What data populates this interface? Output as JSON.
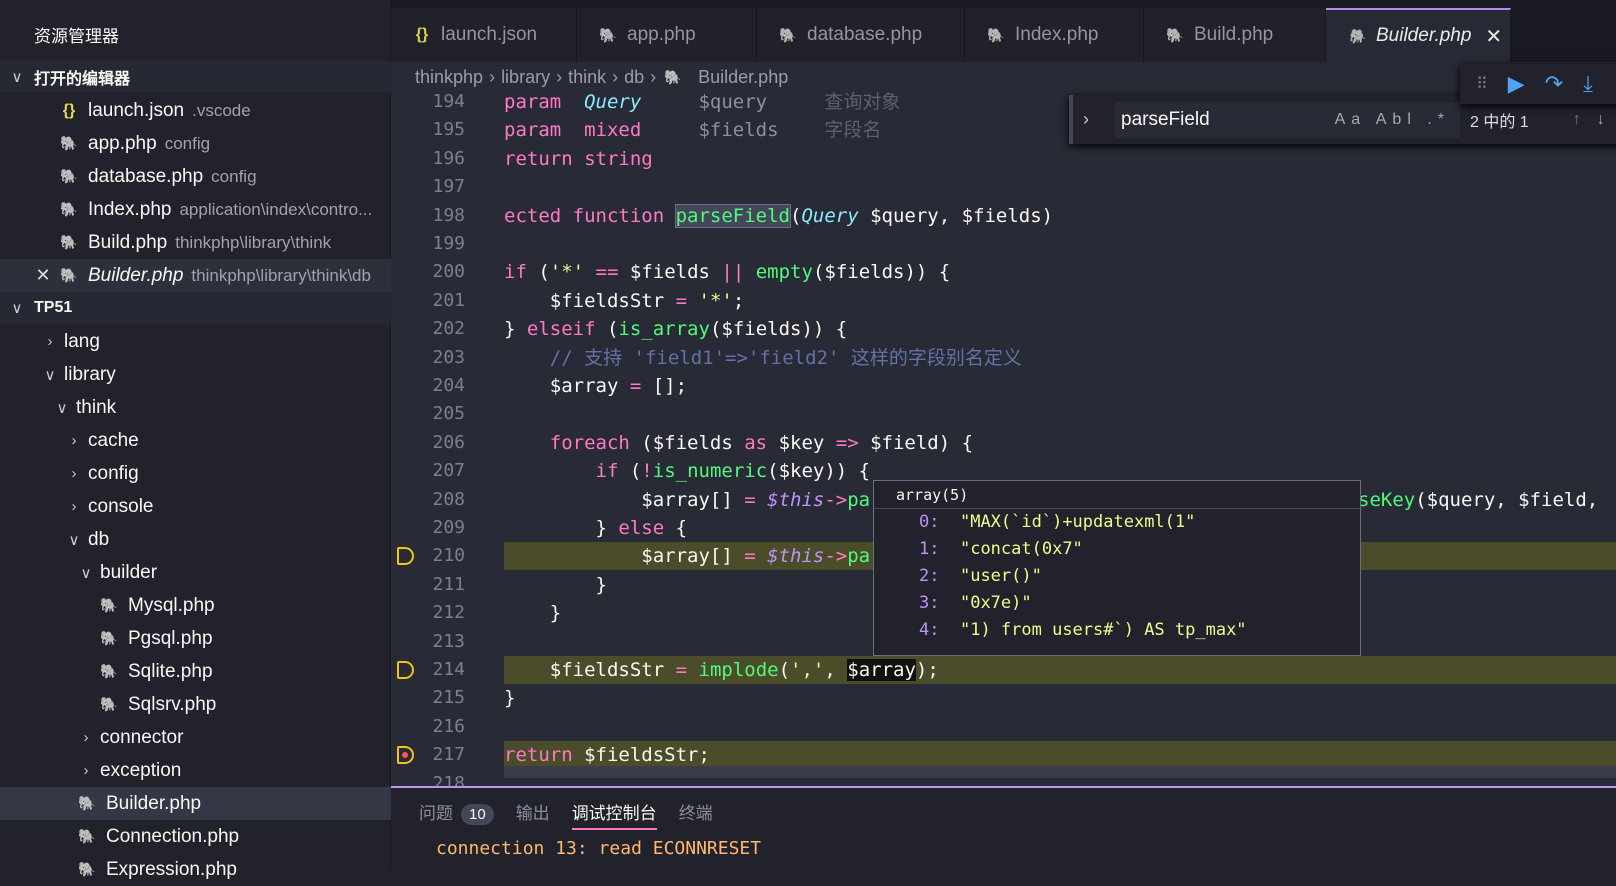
{
  "sidebar": {
    "title": "资源管理器",
    "open_editors": {
      "label": "打开的编辑器",
      "items": [
        {
          "name": "launch.json",
          "desc": ".vscode",
          "icon": "json-icon"
        },
        {
          "name": "app.php",
          "desc": "config",
          "icon": "php-icon"
        },
        {
          "name": "database.php",
          "desc": "config",
          "icon": "php-icon"
        },
        {
          "name": "Index.php",
          "desc": "application\\index\\contro...",
          "icon": "php-icon"
        },
        {
          "name": "Build.php",
          "desc": "thinkphp\\library\\think",
          "icon": "php-icon"
        },
        {
          "name": "Builder.php",
          "desc": "thinkphp\\library\\think\\db",
          "icon": "php-icon",
          "active": true
        }
      ]
    },
    "project": {
      "label": "TP51",
      "items": [
        {
          "name": "lang",
          "type": "folder",
          "expanded": false,
          "depth": 0
        },
        {
          "name": "library",
          "type": "folder",
          "expanded": true,
          "depth": 0
        },
        {
          "name": "think",
          "type": "folder",
          "expanded": true,
          "depth": 1
        },
        {
          "name": "cache",
          "type": "folder",
          "expanded": false,
          "depth": 2
        },
        {
          "name": "config",
          "type": "folder",
          "expanded": false,
          "depth": 2
        },
        {
          "name": "console",
          "type": "folder",
          "expanded": false,
          "depth": 2
        },
        {
          "name": "db",
          "type": "folder",
          "expanded": true,
          "depth": 2
        },
        {
          "name": "builder",
          "type": "folder",
          "expanded": true,
          "depth": 3
        },
        {
          "name": "Mysql.php",
          "type": "file",
          "depth": 4
        },
        {
          "name": "Pgsql.php",
          "type": "file",
          "depth": 4
        },
        {
          "name": "Sqlite.php",
          "type": "file",
          "depth": 4
        },
        {
          "name": "Sqlsrv.php",
          "type": "file",
          "depth": 4
        },
        {
          "name": "connector",
          "type": "folder",
          "expanded": false,
          "depth": 3
        },
        {
          "name": "exception",
          "type": "folder",
          "expanded": false,
          "depth": 3
        },
        {
          "name": "Builder.php",
          "type": "file",
          "depth": 3,
          "selected": true
        },
        {
          "name": "Connection.php",
          "type": "file",
          "depth": 3
        },
        {
          "name": "Expression.php",
          "type": "file",
          "depth": 3
        }
      ]
    }
  },
  "tabs": [
    {
      "label": "launch.json",
      "icon": "json-icon"
    },
    {
      "label": "app.php",
      "icon": "php-icon"
    },
    {
      "label": "database.php",
      "icon": "php-icon"
    },
    {
      "label": "Index.php",
      "icon": "php-icon"
    },
    {
      "label": "Build.php",
      "icon": "php-icon"
    },
    {
      "label": "Builder.php",
      "icon": "php-icon",
      "active": true,
      "close": "✕"
    }
  ],
  "breadcrumb": [
    "thinkphp",
    "library",
    "think",
    "db",
    "Builder.php"
  ],
  "code": {
    "lines": [
      {
        "n": "194",
        "t": [
          [
            "param  ",
            "k"
          ],
          [
            "Query",
            "t"
          ],
          [
            "     $query     ",
            "d"
          ],
          [
            "查询对象",
            "dd"
          ]
        ]
      },
      {
        "n": "195",
        "t": [
          [
            "param  ",
            "k"
          ],
          [
            "mixed",
            "k"
          ],
          [
            "     $fields    ",
            "d"
          ],
          [
            "字段名",
            "dd"
          ]
        ]
      },
      {
        "n": "196",
        "t": [
          [
            "return string",
            "k"
          ]
        ]
      },
      {
        "n": "197",
        "t": []
      },
      {
        "n": "198",
        "t": [
          [
            "ected function ",
            "k"
          ],
          [
            "parseField",
            "f match"
          ],
          [
            "(",
            "v"
          ],
          [
            "Query",
            "t"
          ],
          [
            " $query, $fields)",
            "v"
          ]
        ]
      },
      {
        "n": "199",
        "t": []
      },
      {
        "n": "200",
        "t": [
          [
            "if ",
            "k"
          ],
          [
            "(",
            "v"
          ],
          [
            "'*'",
            "s"
          ],
          [
            " == ",
            "k"
          ],
          [
            "$fields ",
            "v"
          ],
          [
            "||",
            "k"
          ],
          [
            " ",
            "v"
          ],
          [
            "empty",
            "f"
          ],
          [
            "($fields)) {",
            "v"
          ]
        ]
      },
      {
        "n": "201",
        "t": [
          [
            "    $fieldsStr ",
            "v"
          ],
          [
            "=",
            "k"
          ],
          [
            " ",
            "v"
          ],
          [
            "'*'",
            "s"
          ],
          [
            ";",
            "v"
          ]
        ]
      },
      {
        "n": "202",
        "t": [
          [
            "} ",
            "v"
          ],
          [
            "elseif",
            "k"
          ],
          [
            " (",
            "v"
          ],
          [
            "is_array",
            "f"
          ],
          [
            "($fields)) {",
            "v"
          ]
        ]
      },
      {
        "n": "203",
        "t": [
          [
            "    // 支持 'field1'=>'field2' 这样的字段别名定义",
            "c"
          ]
        ]
      },
      {
        "n": "204",
        "t": [
          [
            "    $array ",
            "v"
          ],
          [
            "=",
            "k"
          ],
          [
            " [];",
            "v"
          ]
        ]
      },
      {
        "n": "205",
        "t": []
      },
      {
        "n": "206",
        "t": [
          [
            "    ",
            "v"
          ],
          [
            "foreach",
            "k"
          ],
          [
            " ($fields ",
            "v"
          ],
          [
            "as",
            "k"
          ],
          [
            " $key ",
            "v"
          ],
          [
            "=>",
            "k"
          ],
          [
            " $field) {",
            "v"
          ]
        ]
      },
      {
        "n": "207",
        "t": [
          [
            "        ",
            "v"
          ],
          [
            "if",
            "k"
          ],
          [
            " (",
            "v"
          ],
          [
            "!",
            "k"
          ],
          [
            "is_numeric",
            "f"
          ],
          [
            "($key)) {",
            "v"
          ]
        ]
      },
      {
        "n": "208",
        "t": [
          [
            "            $array[] ",
            "v"
          ],
          [
            "=",
            "k"
          ],
          [
            " ",
            "v"
          ],
          [
            "$this",
            "th"
          ],
          [
            "->",
            "k"
          ],
          [
            "pa",
            "f"
          ]
        ],
        "tail": [
          [
            "seKey",
            "f"
          ],
          [
            "($query, $field, ",
            "v"
          ]
        ]
      },
      {
        "n": "209",
        "t": [
          [
            "        } ",
            "v"
          ],
          [
            "else",
            "k"
          ],
          [
            " {",
            "v"
          ]
        ]
      },
      {
        "n": "210",
        "t": [
          [
            "            $array[] ",
            "v"
          ],
          [
            "=",
            "k"
          ],
          [
            " ",
            "v"
          ],
          [
            "$this",
            "th"
          ],
          [
            "->",
            "k"
          ],
          [
            "pa",
            "f"
          ]
        ],
        "bp": true
      },
      {
        "n": "211",
        "t": [
          [
            "        }",
            "v"
          ]
        ]
      },
      {
        "n": "212",
        "t": [
          [
            "    }",
            "v"
          ]
        ]
      },
      {
        "n": "213",
        "t": []
      },
      {
        "n": "214",
        "t": [
          [
            "    $fieldsStr ",
            "v"
          ],
          [
            "=",
            "k"
          ],
          [
            " ",
            "v"
          ],
          [
            "implode",
            "f"
          ],
          [
            "(",
            "v"
          ],
          [
            "','",
            "s"
          ],
          [
            ", ",
            "v"
          ],
          [
            "$array",
            "v sel-w"
          ],
          [
            ");",
            "v"
          ]
        ],
        "bp": true
      },
      {
        "n": "215",
        "t": [
          [
            "}",
            "v"
          ]
        ]
      },
      {
        "n": "216",
        "t": []
      },
      {
        "n": "217",
        "t": [
          [
            "return",
            "k"
          ],
          [
            " $fieldsStr;",
            "v"
          ]
        ],
        "bp": true,
        "current": true
      },
      {
        "n": "218",
        "t": []
      }
    ]
  },
  "hover": {
    "title": "array(5)",
    "items": [
      {
        "i": "0:",
        "v": "\"MAX(`id`)+updatexml(1\""
      },
      {
        "i": "1:",
        "v": "\"concat(0x7\""
      },
      {
        "i": "2:",
        "v": "\"user()\""
      },
      {
        "i": "3:",
        "v": "\"0x7e)\""
      },
      {
        "i": "4:",
        "v": "\"1) from users#`) AS tp_max\""
      }
    ]
  },
  "find": {
    "value": "parseField",
    "options": "Aa Abl .*",
    "count": "2 中的 1"
  },
  "panel": {
    "tabs": [
      {
        "label": "问题",
        "badge": "10"
      },
      {
        "label": "输出"
      },
      {
        "label": "调试控制台",
        "active": true
      },
      {
        "label": "终端"
      }
    ],
    "console": "connection 13: read ECONNRESET"
  },
  "colors": {
    "accent": "#bd93f9",
    "keyword": "#ff79c6",
    "function": "#50fa7b",
    "type": "#8be9fd",
    "string": "#f1fa8c",
    "debug_line": "#4b4d2a"
  }
}
